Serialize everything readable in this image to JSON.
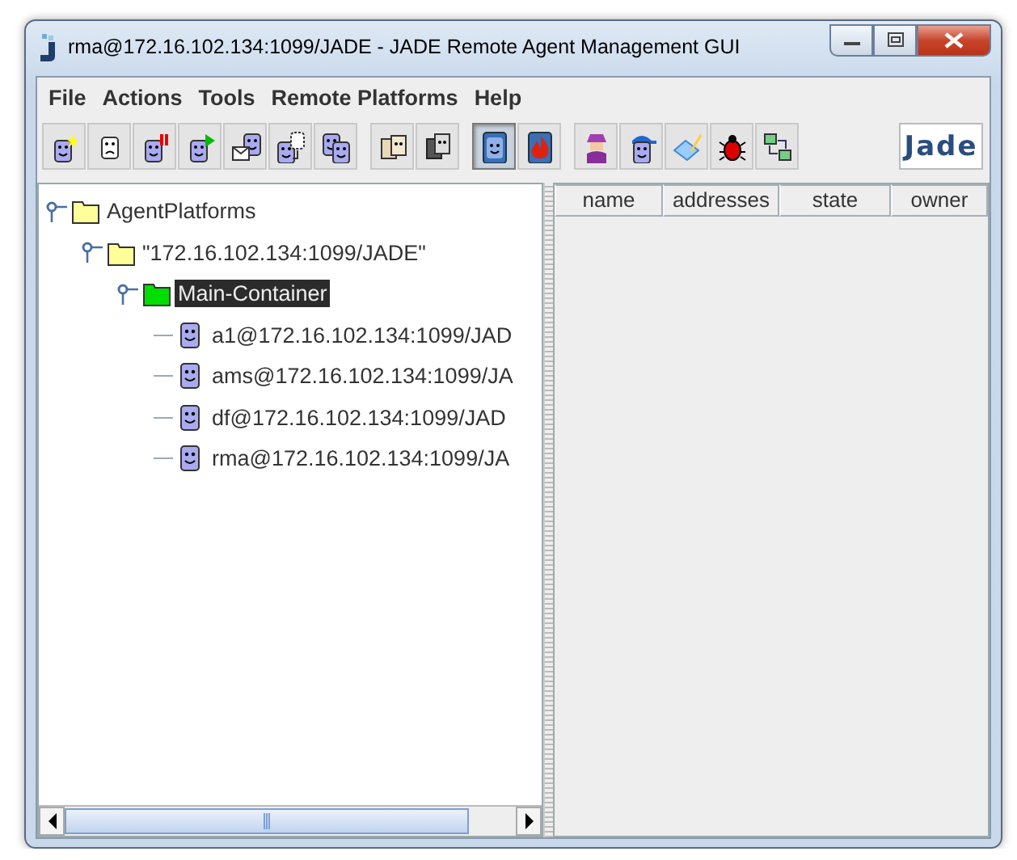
{
  "window": {
    "title": "rma@172.16.102.134:1099/JADE - JADE Remote Agent Management GUI"
  },
  "menu": [
    "File",
    "Actions",
    "Tools",
    "Remote Platforms",
    "Help"
  ],
  "toolbar": [
    [
      {
        "kind": "star",
        "pressed": false
      },
      {
        "kind": "frown",
        "pressed": false
      },
      {
        "kind": "pause",
        "pressed": false
      },
      {
        "kind": "play",
        "pressed": false
      },
      {
        "kind": "envelope",
        "pressed": false
      },
      {
        "kind": "move",
        "pressed": false
      },
      {
        "kind": "pair",
        "pressed": false
      }
    ],
    [
      {
        "kind": "save",
        "pressed": false
      },
      {
        "kind": "load",
        "pressed": false
      }
    ],
    [
      {
        "kind": "screen",
        "pressed": true
      },
      {
        "kind": "fire",
        "pressed": false
      }
    ],
    [
      {
        "kind": "spy",
        "pressed": false
      },
      {
        "kind": "cap",
        "pressed": false
      },
      {
        "kind": "pencil",
        "pressed": false
      },
      {
        "kind": "bug",
        "pressed": false
      },
      {
        "kind": "network",
        "pressed": false
      }
    ]
  ],
  "logo": "Jade",
  "tree": [
    {
      "label": "AgentPlatforms",
      "kind": "folder",
      "expanded": true,
      "selected": false,
      "children": [
        {
          "label": "\"172.16.102.134:1099/JADE\"",
          "kind": "folder",
          "expanded": true,
          "selected": false,
          "children": [
            {
              "label": "Main-Container",
              "kind": "container",
              "expanded": true,
              "selected": true,
              "children": [
                {
                  "label": "a1@172.16.102.134:1099/JAD",
                  "kind": "agent",
                  "selected": false
                },
                {
                  "label": "ams@172.16.102.134:1099/JA",
                  "kind": "agent",
                  "selected": false
                },
                {
                  "label": "df@172.16.102.134:1099/JAD",
                  "kind": "agent",
                  "selected": false
                },
                {
                  "label": "rma@172.16.102.134:1099/JA",
                  "kind": "agent",
                  "selected": false
                }
              ]
            }
          ]
        }
      ]
    }
  ],
  "table": {
    "columns": [
      "name",
      "addresses",
      "state",
      "owner"
    ]
  }
}
